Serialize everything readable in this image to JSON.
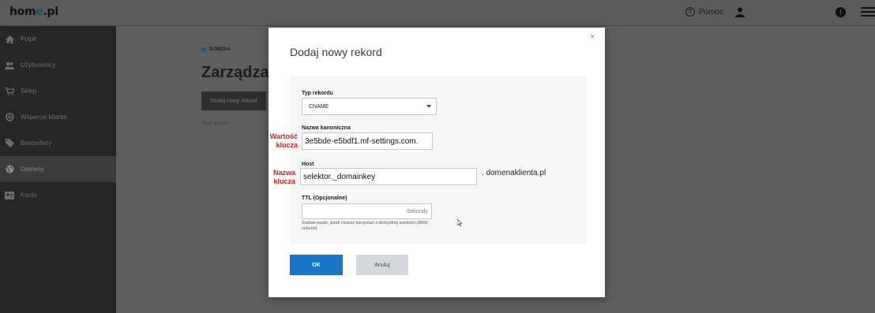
{
  "app": {
    "logo_main": "hom",
    "logo_accent": "e",
    "logo_tail": ".pl"
  },
  "topbar": {
    "help_label": "Pomoc"
  },
  "sidebar": {
    "items": [
      {
        "label": "Pulpit",
        "icon": "home-icon"
      },
      {
        "label": "Użytkownicy",
        "icon": "users-icon"
      },
      {
        "label": "Sklep",
        "icon": "cart-icon"
      },
      {
        "label": "Wsparcie klienta",
        "icon": "support-icon"
      },
      {
        "label": "Bestsellery",
        "icon": "tag-icon"
      },
      {
        "label": "Domeny",
        "icon": "globe-icon",
        "active": true
      },
      {
        "label": "Konto",
        "icon": "account-icon"
      }
    ]
  },
  "main": {
    "breadcrumb": "DOMENA",
    "title": "Zarządzaj r",
    "add_record_label": "Dodaj nowy rekord",
    "empty_text": "Brak danych"
  },
  "modal": {
    "title": "Dodaj nowy rekord",
    "close_label": "×",
    "record_type": {
      "label": "Typ rekordu",
      "value": "CNAME"
    },
    "canonical": {
      "label": "Nazwa kanoniczna",
      "value": "3e5bde-e5bdf1.mf-settings.com."
    },
    "host": {
      "label": "Host",
      "value": "selektor._domainkey",
      "suffix": ". domenaklienta.pl"
    },
    "ttl": {
      "label": "TTL (Opcjonalne)",
      "unit": "Sekundy",
      "help": "Zostaw puste, jeżeli chcesz korzystać z domyślnej wartości (3600 sekund)"
    },
    "ok_label": "OK",
    "cancel_label": "Anuluj"
  },
  "annotations": {
    "value_line1": "Wartość",
    "value_line2": "klucza",
    "name_line1": "Nazwa",
    "name_line2": "klucza"
  },
  "colors": {
    "primary": "#1976c7",
    "annotation": "#d11f1f",
    "sidebar": "#262626"
  }
}
